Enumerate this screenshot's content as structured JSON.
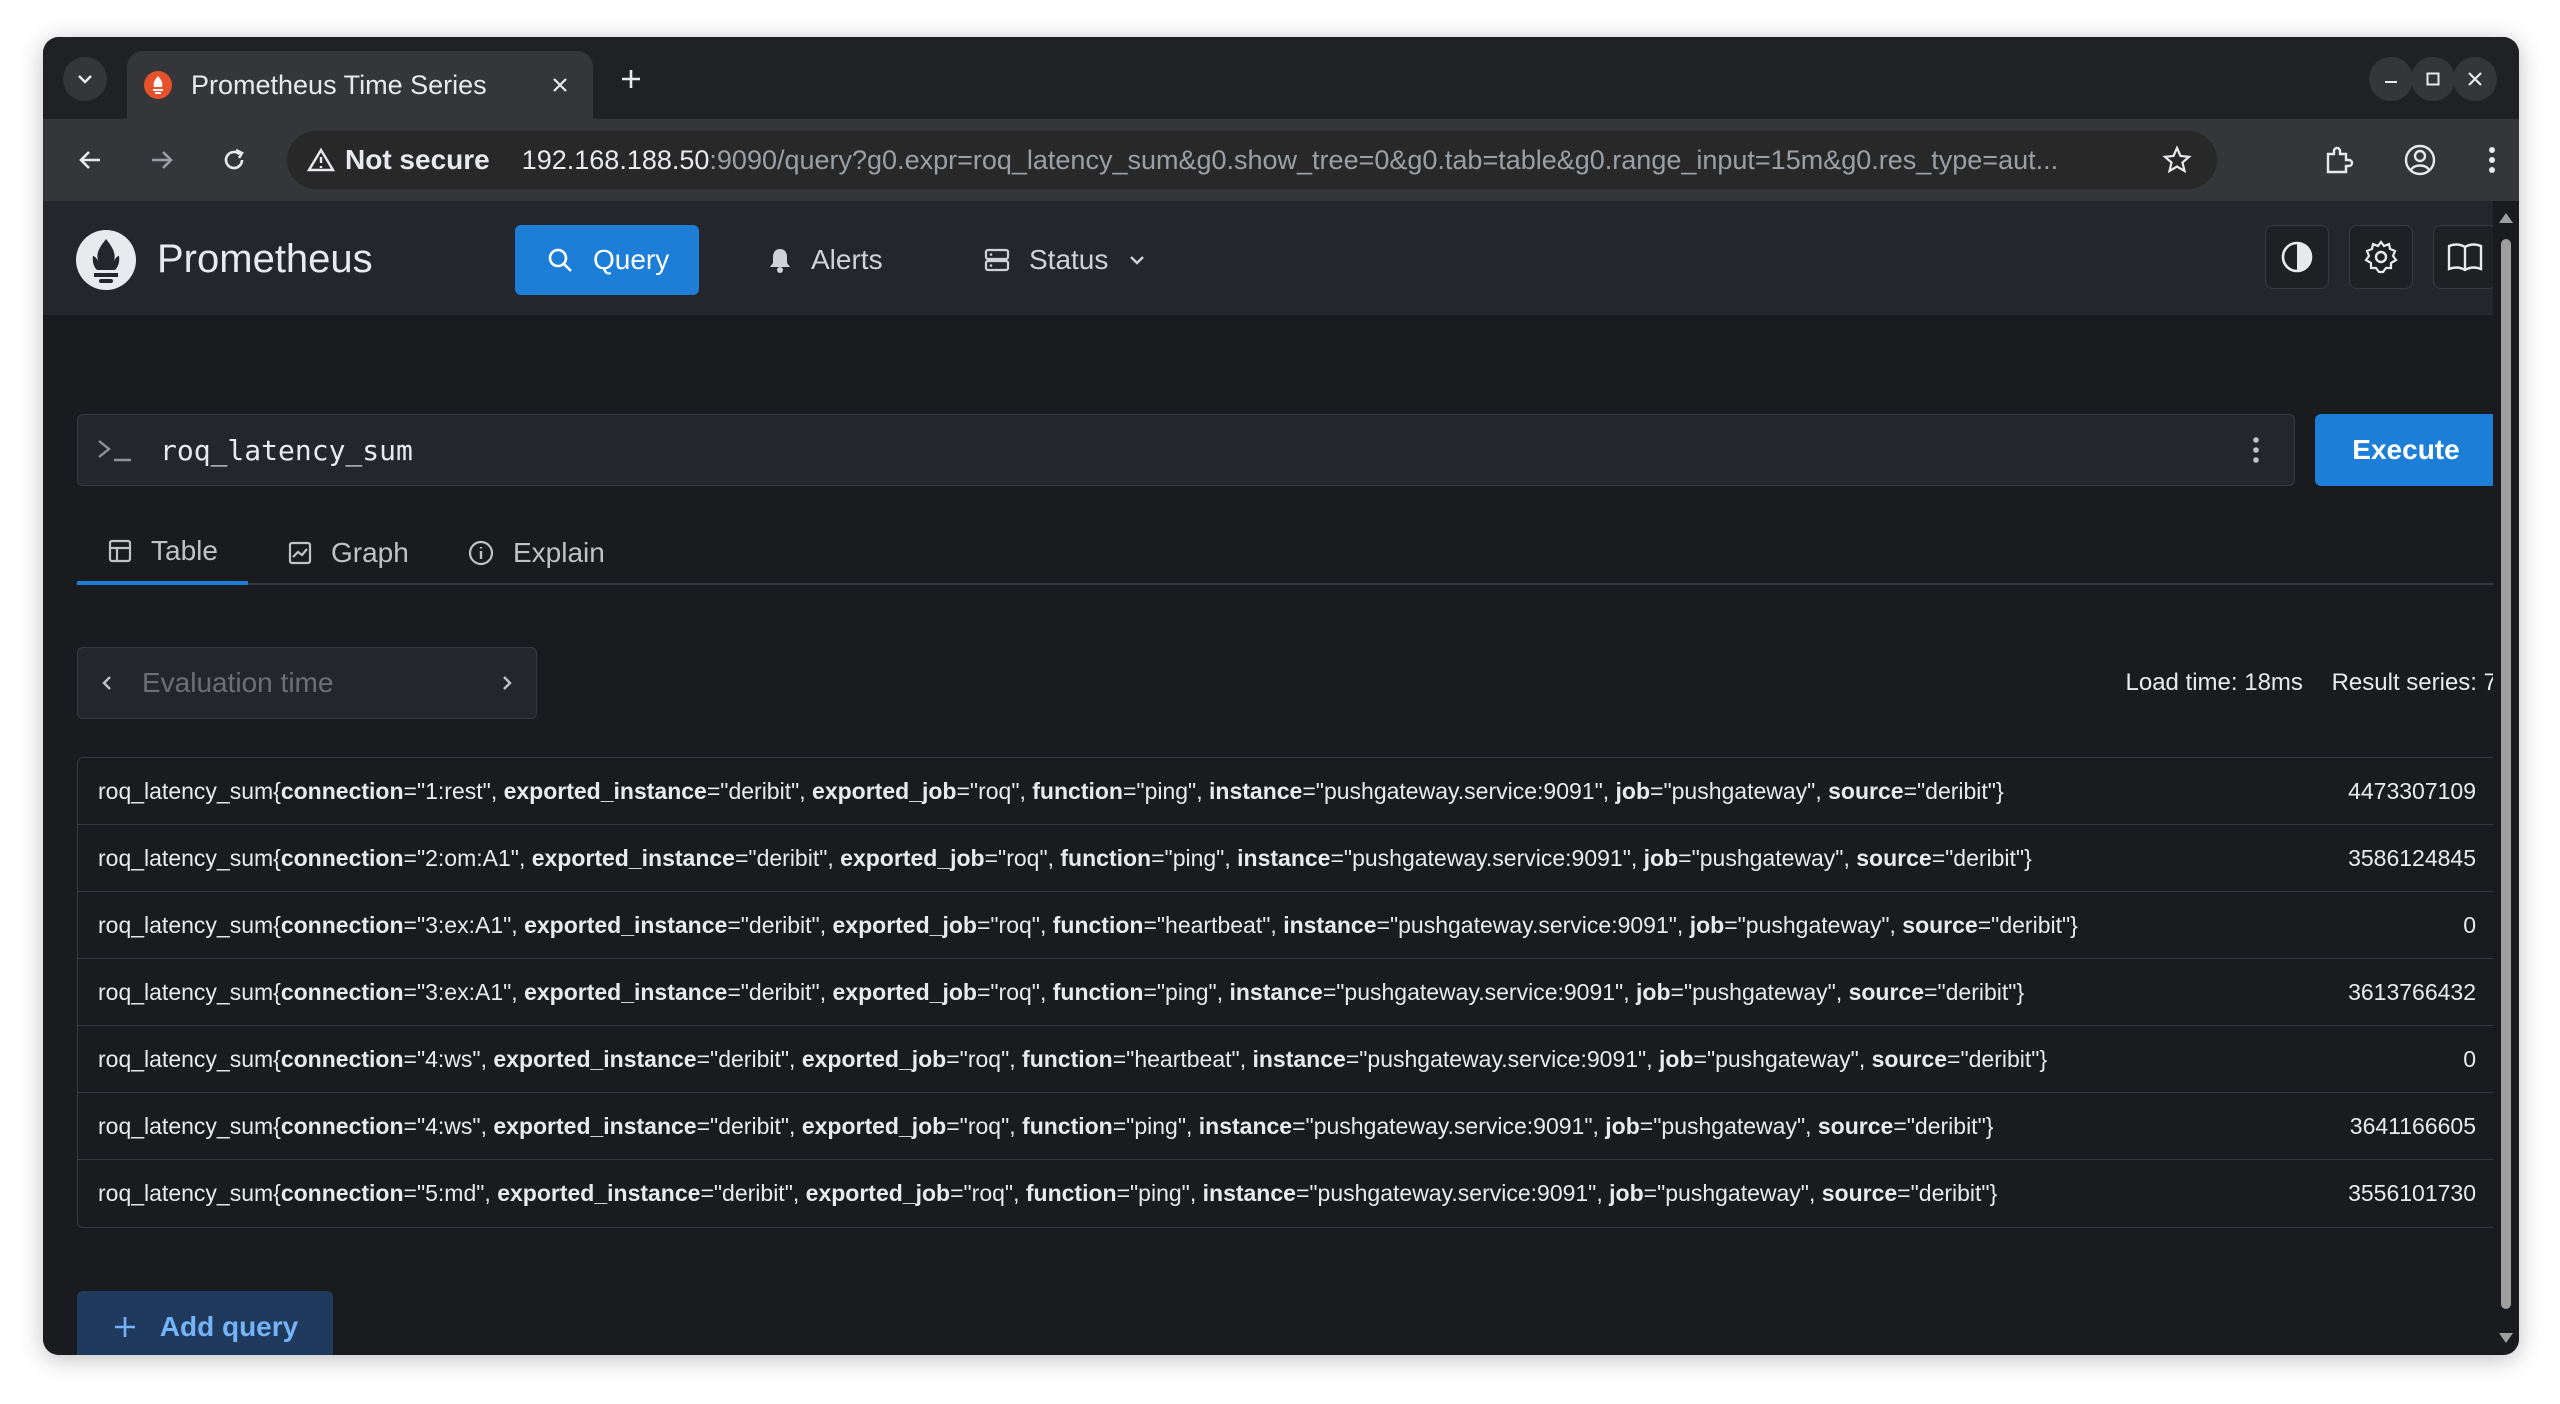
{
  "browser": {
    "tab_title": "Prometheus Time Series",
    "security_label": "Not secure",
    "url_host": "192.168.188.50",
    "url_rest": ":9090/query?g0.expr=roq_latency_sum&g0.show_tree=0&g0.tab=table&g0.range_input=15m&g0.res_type=aut..."
  },
  "header": {
    "brand": "Prometheus",
    "nav": [
      {
        "label": "Query",
        "icon": "search-icon",
        "active": true
      },
      {
        "label": "Alerts",
        "icon": "bell-icon"
      },
      {
        "label": "Status",
        "icon": "server-icon"
      }
    ]
  },
  "query": {
    "expression": "roq_latency_sum",
    "execute_label": "Execute"
  },
  "panel_tabs": [
    {
      "label": "Table",
      "icon": "table-icon",
      "active": true
    },
    {
      "label": "Graph",
      "icon": "graph-icon"
    },
    {
      "label": "Explain",
      "icon": "info-icon"
    }
  ],
  "evaluation": {
    "placeholder": "Evaluation time"
  },
  "stats": {
    "load_time": "Load time: 18ms",
    "result_series": "Result series: 7"
  },
  "results": [
    {
      "metric": "roq_latency_sum",
      "labels": [
        [
          "connection",
          "\"1:rest\""
        ],
        [
          "exported_instance",
          "\"deribit\""
        ],
        [
          "exported_job",
          "\"roq\""
        ],
        [
          "function",
          "\"ping\""
        ],
        [
          "instance",
          "\"pushgateway.service:9091\""
        ],
        [
          "job",
          "\"pushgateway\""
        ],
        [
          "source",
          "\"deribit\""
        ]
      ],
      "value": "4473307109"
    },
    {
      "metric": "roq_latency_sum",
      "labels": [
        [
          "connection",
          "\"2:om:A1\""
        ],
        [
          "exported_instance",
          "\"deribit\""
        ],
        [
          "exported_job",
          "\"roq\""
        ],
        [
          "function",
          "\"ping\""
        ],
        [
          "instance",
          "\"pushgateway.service:9091\""
        ],
        [
          "job",
          "\"pushgateway\""
        ],
        [
          "source",
          "\"deribit\""
        ]
      ],
      "value": "3586124845"
    },
    {
      "metric": "roq_latency_sum",
      "labels": [
        [
          "connection",
          "\"3:ex:A1\""
        ],
        [
          "exported_instance",
          "\"deribit\""
        ],
        [
          "exported_job",
          "\"roq\""
        ],
        [
          "function",
          "\"heartbeat\""
        ],
        [
          "instance",
          "\"pushgateway.service:9091\""
        ],
        [
          "job",
          "\"pushgateway\""
        ],
        [
          "source",
          "\"deribit\""
        ]
      ],
      "value": "0"
    },
    {
      "metric": "roq_latency_sum",
      "labels": [
        [
          "connection",
          "\"3:ex:A1\""
        ],
        [
          "exported_instance",
          "\"deribit\""
        ],
        [
          "exported_job",
          "\"roq\""
        ],
        [
          "function",
          "\"ping\""
        ],
        [
          "instance",
          "\"pushgateway.service:9091\""
        ],
        [
          "job",
          "\"pushgateway\""
        ],
        [
          "source",
          "\"deribit\""
        ]
      ],
      "value": "3613766432"
    },
    {
      "metric": "roq_latency_sum",
      "labels": [
        [
          "connection",
          "\"4:ws\""
        ],
        [
          "exported_instance",
          "\"deribit\""
        ],
        [
          "exported_job",
          "\"roq\""
        ],
        [
          "function",
          "\"heartbeat\""
        ],
        [
          "instance",
          "\"pushgateway.service:9091\""
        ],
        [
          "job",
          "\"pushgateway\""
        ],
        [
          "source",
          "\"deribit\""
        ]
      ],
      "value": "0"
    },
    {
      "metric": "roq_latency_sum",
      "labels": [
        [
          "connection",
          "\"4:ws\""
        ],
        [
          "exported_instance",
          "\"deribit\""
        ],
        [
          "exported_job",
          "\"roq\""
        ],
        [
          "function",
          "\"ping\""
        ],
        [
          "instance",
          "\"pushgateway.service:9091\""
        ],
        [
          "job",
          "\"pushgateway\""
        ],
        [
          "source",
          "\"deribit\""
        ]
      ],
      "value": "3641166605"
    },
    {
      "metric": "roq_latency_sum",
      "labels": [
        [
          "connection",
          "\"5:md\""
        ],
        [
          "exported_instance",
          "\"deribit\""
        ],
        [
          "exported_job",
          "\"roq\""
        ],
        [
          "function",
          "\"ping\""
        ],
        [
          "instance",
          "\"pushgateway.service:9091\""
        ],
        [
          "job",
          "\"pushgateway\""
        ],
        [
          "source",
          "\"deribit\""
        ]
      ],
      "value": "3556101730"
    }
  ],
  "add_query_label": "Add query",
  "colors": {
    "accent": "#1c7ed6",
    "page_bg": "#1a1b1e",
    "header_bg": "#25262b"
  }
}
